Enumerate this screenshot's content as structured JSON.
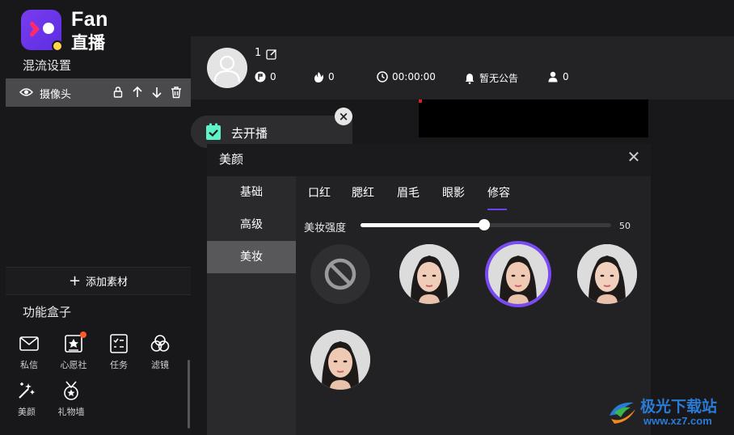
{
  "app": {
    "logo_en": "Fan",
    "logo_cn": "直播",
    "accent": "#6b3ff2",
    "brand_gradient": [
      "#7a3cf0",
      "#5b2ee0"
    ]
  },
  "sidebar": {
    "mix_title": "混流设置",
    "sources": [
      {
        "label": "摄像头",
        "icons": [
          "eye-icon",
          "lock-icon",
          "arrow-up-icon",
          "arrow-down-icon",
          "trash-icon"
        ]
      }
    ],
    "add_material": "添加素材",
    "func_title": "功能盒子",
    "functions": [
      {
        "label": "私信",
        "icon": "mail-icon"
      },
      {
        "label": "心愿社",
        "icon": "wish-icon",
        "badge": true
      },
      {
        "label": "任务",
        "icon": "task-icon"
      },
      {
        "label": "滤镜",
        "icon": "filter-icon"
      },
      {
        "label": "美颜",
        "icon": "magic-wand-icon"
      },
      {
        "label": "礼物墙",
        "icon": "medal-icon"
      }
    ]
  },
  "topbar": {
    "user_name": "1",
    "stats": [
      {
        "icon": "coin-icon",
        "value": "0"
      },
      {
        "icon": "fire-icon",
        "value": "0"
      },
      {
        "icon": "clock-icon",
        "value": "00:00:00"
      },
      {
        "icon": "bell-icon",
        "value": "暂无公告"
      },
      {
        "icon": "user-icon",
        "value": "0"
      }
    ]
  },
  "go_live": {
    "label": "去开播",
    "close": "×"
  },
  "beauty": {
    "title": "美颜",
    "close": "✕",
    "menu": [
      "基础",
      "高级",
      "美妆"
    ],
    "active_menu": "美妆",
    "tabs": [
      "口红",
      "腮红",
      "眉毛",
      "眼影",
      "修容"
    ],
    "active_tab": "修容",
    "intensity_label": "美妆强度",
    "intensity_value": "50",
    "intensity": 50,
    "options": [
      {
        "kind": "none"
      },
      {
        "kind": "face"
      },
      {
        "kind": "face",
        "selected": true
      },
      {
        "kind": "face"
      },
      {
        "kind": "face"
      }
    ]
  },
  "watermark": {
    "text_cn": "极光下载站",
    "text_url": "www.xz7.com"
  }
}
